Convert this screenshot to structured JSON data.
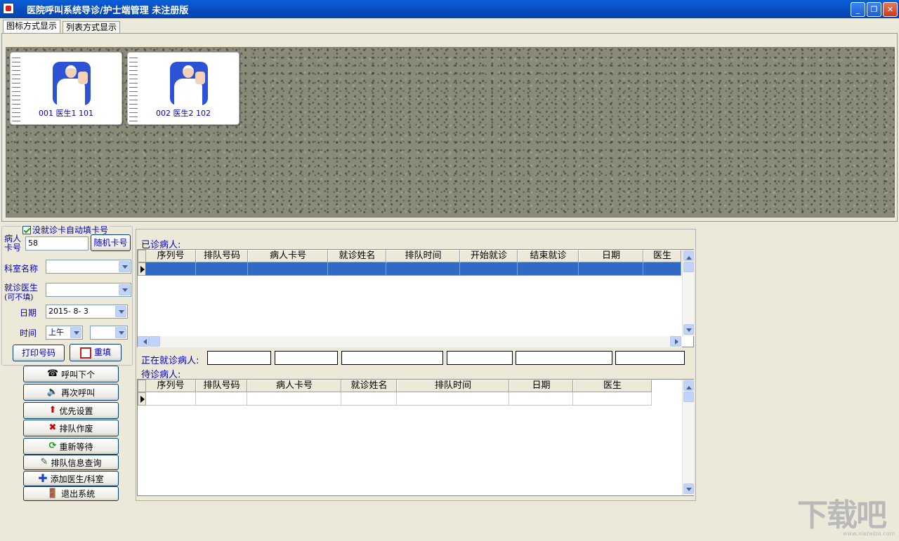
{
  "window": {
    "title": "医院呼叫系统导诊/护士端管理 未注册版",
    "buttons": {
      "minimize": "_",
      "maximize": "❐",
      "close": "✕"
    }
  },
  "tabs": [
    {
      "label": "图标方式显示",
      "selected": true
    },
    {
      "label": "列表方式显示",
      "selected": false
    }
  ],
  "doctors": [
    {
      "label": "001 医生1 101"
    },
    {
      "label": "002 医生2 102"
    }
  ],
  "form": {
    "auto_fill_label": "没就诊卡自动填卡号",
    "auto_fill_checked": true,
    "card_label": "病人卡号",
    "card_label_line1": "病人",
    "card_label_line2": "卡号",
    "card_value": "58",
    "random_card_button": "随机卡号",
    "dept_label": "科室名称",
    "dept_value": "",
    "doctor_label_line1": "就诊医生",
    "doctor_label_line2": "(可不填)",
    "doctor_value": "",
    "date_label": "日期",
    "date_value": "2015- 8- 3",
    "time_label": "时间",
    "time_period": "上午",
    "time_value": "",
    "print_button": "打印号码",
    "reset_button": "重填"
  },
  "actions": [
    {
      "label": "呼叫下个",
      "icon": "phone-icon"
    },
    {
      "label": "再次呼叫",
      "icon": "speaker-icon"
    },
    {
      "label": "优先设置",
      "icon": "arrow-up-icon"
    },
    {
      "label": "排队作废",
      "icon": "x-icon"
    },
    {
      "label": "重新等待",
      "icon": "refresh-icon"
    },
    {
      "label": "排队信息查询",
      "icon": "query-icon"
    },
    {
      "label": "添加医生/科室",
      "icon": "plus-icon"
    },
    {
      "label": "退出系统",
      "icon": "exit-icon"
    }
  ],
  "visited": {
    "title": "已诊病人:",
    "columns": [
      "序列号",
      "排队号码",
      "病人卡号",
      "就诊姓名",
      "排队时间",
      "开始就诊",
      "结束就诊",
      "日期",
      "医生"
    ]
  },
  "current": {
    "title": "正在就诊病人:"
  },
  "waiting": {
    "title": "待诊病人:",
    "columns": [
      "序列号",
      "排队号码",
      "病人卡号",
      "就诊姓名",
      "排队时间",
      "日期",
      "医生"
    ]
  },
  "watermark": {
    "text": "下载吧",
    "url": "www.xiazaiba.com"
  }
}
